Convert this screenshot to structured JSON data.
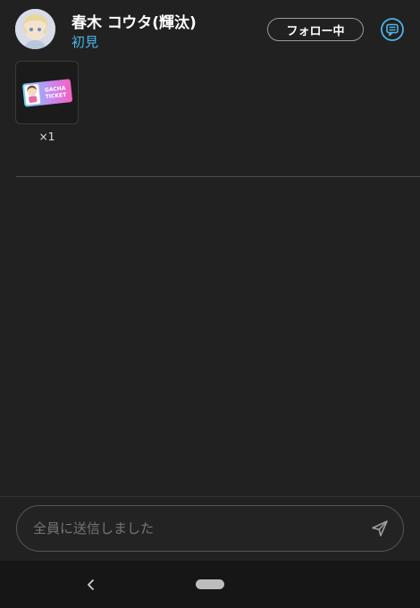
{
  "header": {
    "name": "春木 コウタ(輝汰)",
    "rank": "初見",
    "follow_label": "フォロー中",
    "chat_icon": "chat-bubble-icon",
    "avatar": "avatar-illustration"
  },
  "gifts": [
    {
      "icon": "gacha-ticket-icon",
      "ticket_text_line1": "GACHA",
      "ticket_text_line2": "TICKET",
      "count": "×1"
    }
  ],
  "input": {
    "placeholder": "全員に送信しました",
    "send_icon": "send-icon"
  },
  "navbar": {
    "back_icon": "back-chevron-icon",
    "home_icon": "home-pill-icon"
  },
  "colors": {
    "background": "#212121",
    "accent": "#4fb3e6",
    "navbar": "#161616"
  }
}
